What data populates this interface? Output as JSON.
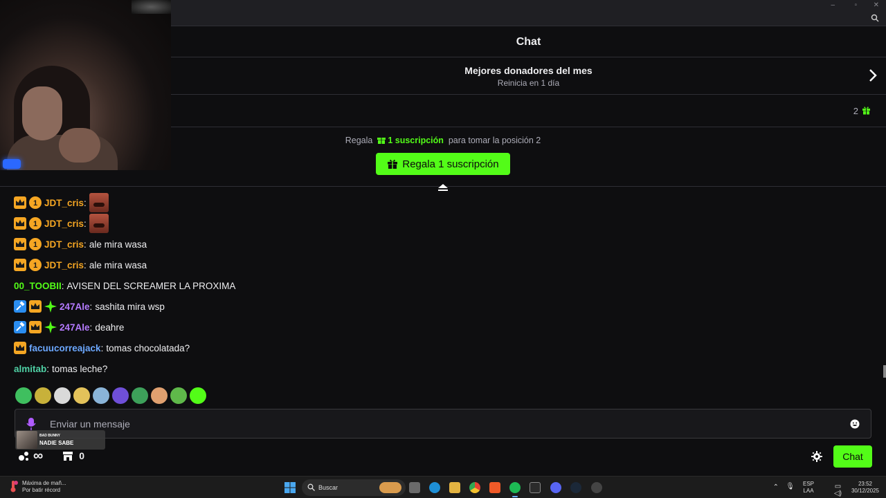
{
  "window": {
    "title": "Chat",
    "controls": [
      "–",
      "▫",
      "✕"
    ]
  },
  "donors": {
    "title": "Mejores donadores del mes",
    "subtitle": "Reinicia en 1 día",
    "gift_count": "2"
  },
  "gift_prompt": {
    "prefix": "Regala",
    "highlight": "1 suscripción",
    "suffix": "para tomar la posición 2",
    "button_label": "Regala 1 suscripción"
  },
  "messages": [
    {
      "badges": [
        "crown",
        "one"
      ],
      "user": "JDT_cris",
      "color": "#f5a623",
      "text": "",
      "emote": true
    },
    {
      "badges": [
        "crown",
        "one"
      ],
      "user": "JDT_cris",
      "color": "#f5a623",
      "text": "",
      "emote": true
    },
    {
      "badges": [
        "crown",
        "one"
      ],
      "user": "JDT_cris",
      "color": "#f5a623",
      "text": "ale mira wasa",
      "emote": false
    },
    {
      "badges": [
        "crown",
        "one"
      ],
      "user": "JDT_cris",
      "color": "#f5a623",
      "text": "ale mira wasa",
      "emote": false
    },
    {
      "badges": [],
      "user": "00_TOOBII",
      "color": "#53fc18",
      "text": "AVISEN DEL SCREAMER LA PROXIMA",
      "emote": false
    },
    {
      "badges": [
        "hammer",
        "crown",
        "star"
      ],
      "user": "247Ale",
      "color": "#b57bff",
      "text": "sashita mira wsp",
      "emote": false
    },
    {
      "badges": [
        "hammer",
        "crown",
        "star"
      ],
      "user": "247Ale",
      "color": "#b57bff",
      "text": "deahre",
      "emote": false
    },
    {
      "badges": [
        "crown"
      ],
      "user": "facuucorreajack",
      "color": "#6ca8ff",
      "text": "tomas chocolatada?",
      "emote": false
    },
    {
      "badges": [],
      "user": "almitab",
      "color": "#4fd1a5",
      "text": "tomas leche?",
      "emote": false
    }
  ],
  "emote_bar": [
    "#3fbf5f",
    "#c8b13a",
    "#d9d9d9",
    "#e3c25a",
    "#8ab4d8",
    "#6f4fd8",
    "#3da05a",
    "#e0a070",
    "#5fb84a",
    "#53fc18"
  ],
  "input": {
    "placeholder": "Enviar un mensaje"
  },
  "spotify": {
    "artist": "BAD BUNNY",
    "song": "NADIE SABE"
  },
  "footer": {
    "points": "∞",
    "store_count": "0",
    "send_label": "Chat"
  },
  "taskbar": {
    "notif_title": "Máxima de mañ...",
    "notif_sub": "Por batir récord",
    "search_label": "Buscar",
    "lang": "ESP",
    "lang_sub": "LAA",
    "time": "23:52",
    "date": "30/12/2025"
  },
  "colors": {
    "accent": "#53fc18",
    "background": "#0e0e10"
  }
}
